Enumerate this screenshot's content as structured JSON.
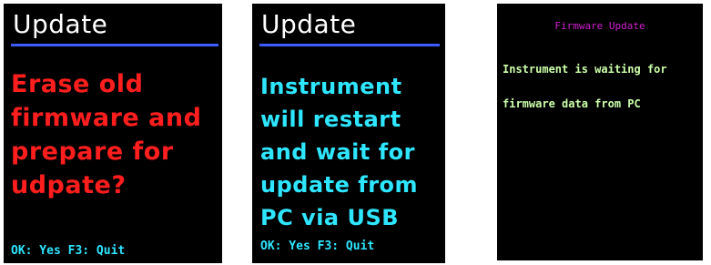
{
  "colors": {
    "screen_bg": "#000000",
    "title_white": "#ffffff",
    "divider_blue": "#3c5cff",
    "warning_red": "#ff1e1e",
    "info_cyan": "#2ee6ff",
    "firmware_magenta": "#d020d0",
    "firmware_text": "#ccffaa"
  },
  "screen1": {
    "title": "Update",
    "message": "Erase old\nfirmware and\nprepare for\nudpate?",
    "footer": "OK: Yes  F3: Quit"
  },
  "screen2": {
    "title": "Update",
    "message": "Instrument\nwill restart\nand wait for\nupdate from\nPC via USB",
    "footer": "OK: Yes  F3: Quit"
  },
  "screen3": {
    "title": "Firmware Update",
    "line1": "Instrument is waiting for",
    "line2": "firmware data from PC"
  }
}
